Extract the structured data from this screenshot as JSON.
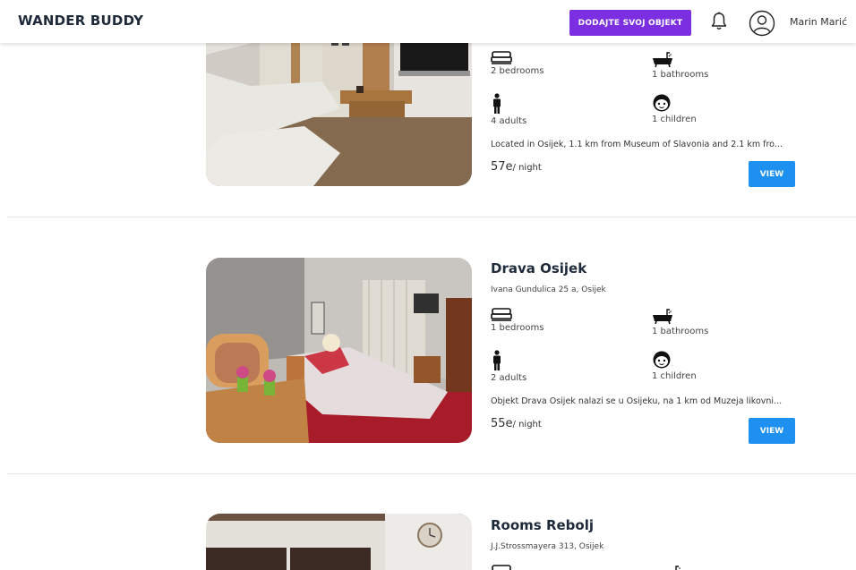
{
  "header": {
    "brand": "WANDER BUDDY",
    "add_property_label": "DODAJTE SVOJ OBJEKT",
    "user_name": "Marin Marić"
  },
  "colors": {
    "accent_purple": "#7b2fe0",
    "view_blue": "#1e90f0"
  },
  "listings": [
    {
      "title": "",
      "address": "",
      "bedrooms": "2 bedrooms",
      "bathrooms": "1 bathrooms",
      "adults": "4 adults",
      "children": "1 children",
      "description": "Located in Osijek, 1.1 km from Museum of Slavonia and 2.1 km fro...",
      "price": "57e",
      "price_unit": "/ night",
      "view_label": "VIEW"
    },
    {
      "title": "Drava Osijek",
      "address": "Ivana Gundulica 25 a, Osijek",
      "bedrooms": "1 bedrooms",
      "bathrooms": "1 bathrooms",
      "adults": "2 adults",
      "children": "1 children",
      "description": "Objekt Drava Osijek nalazi se u Osijeku, na 1 km od Muzeja likovni...",
      "price": "55e",
      "price_unit": "/ night",
      "view_label": "VIEW"
    },
    {
      "title": "Rooms Rebolj",
      "address": "J.J.Strossmayera 313, Osijek"
    }
  ],
  "icons": [
    "bed-icon",
    "bathtub-icon",
    "adult-icon",
    "child-icon",
    "bell-icon",
    "user-icon"
  ]
}
